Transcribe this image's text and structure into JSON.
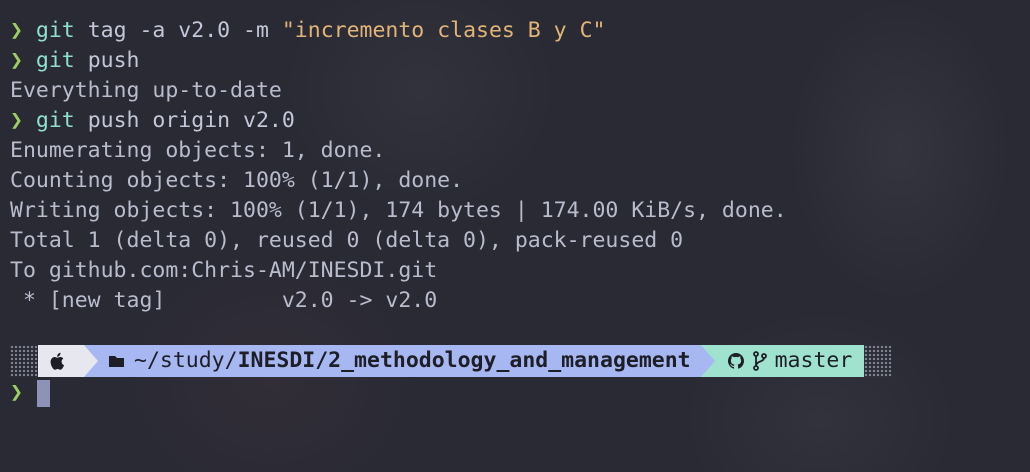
{
  "terminal": {
    "prompt_symbol": "❯",
    "lines": [
      {
        "type": "command",
        "cmd": "git",
        "args": " tag -a v2.0 -m ",
        "string": "\"incremento clases B y C\""
      },
      {
        "type": "command",
        "cmd": "git",
        "args": " push",
        "string": ""
      },
      {
        "type": "output",
        "text": "Everything up-to-date"
      },
      {
        "type": "command",
        "cmd": "git",
        "args": " push origin v2.0",
        "string": ""
      },
      {
        "type": "output",
        "text": "Enumerating objects: 1, done."
      },
      {
        "type": "output",
        "text": "Counting objects: 100% (1/1), done."
      },
      {
        "type": "output",
        "text": "Writing objects: 100% (1/1), 174 bytes | 174.00 KiB/s, done."
      },
      {
        "type": "output",
        "text": "Total 1 (delta 0), reused 0 (delta 0), pack-reused 0"
      },
      {
        "type": "output",
        "text": "To github.com:Chris-AM/INESDI.git"
      },
      {
        "type": "output",
        "text": " * [new tag]         v2.0 -> v2.0"
      }
    ]
  },
  "prompt_bar": {
    "os_icon": "apple-icon",
    "dir_icon": "folder-icon",
    "dir_prefix": "~/study/",
    "dir_bold": "INESDI/2_methodology_and_management",
    "git_icon": "github-icon",
    "branch_icon": "git-branch-icon",
    "branch": "master"
  },
  "colors": {
    "background": "#292a34",
    "prompt_arrow": "#9ccd62",
    "command": "#8fe0d2",
    "string": "#e3b477",
    "seg_os": "#e6e7ef",
    "seg_dir": "#a6b7f2",
    "seg_git": "#9fe3cf",
    "cursor": "#8f92b8"
  }
}
